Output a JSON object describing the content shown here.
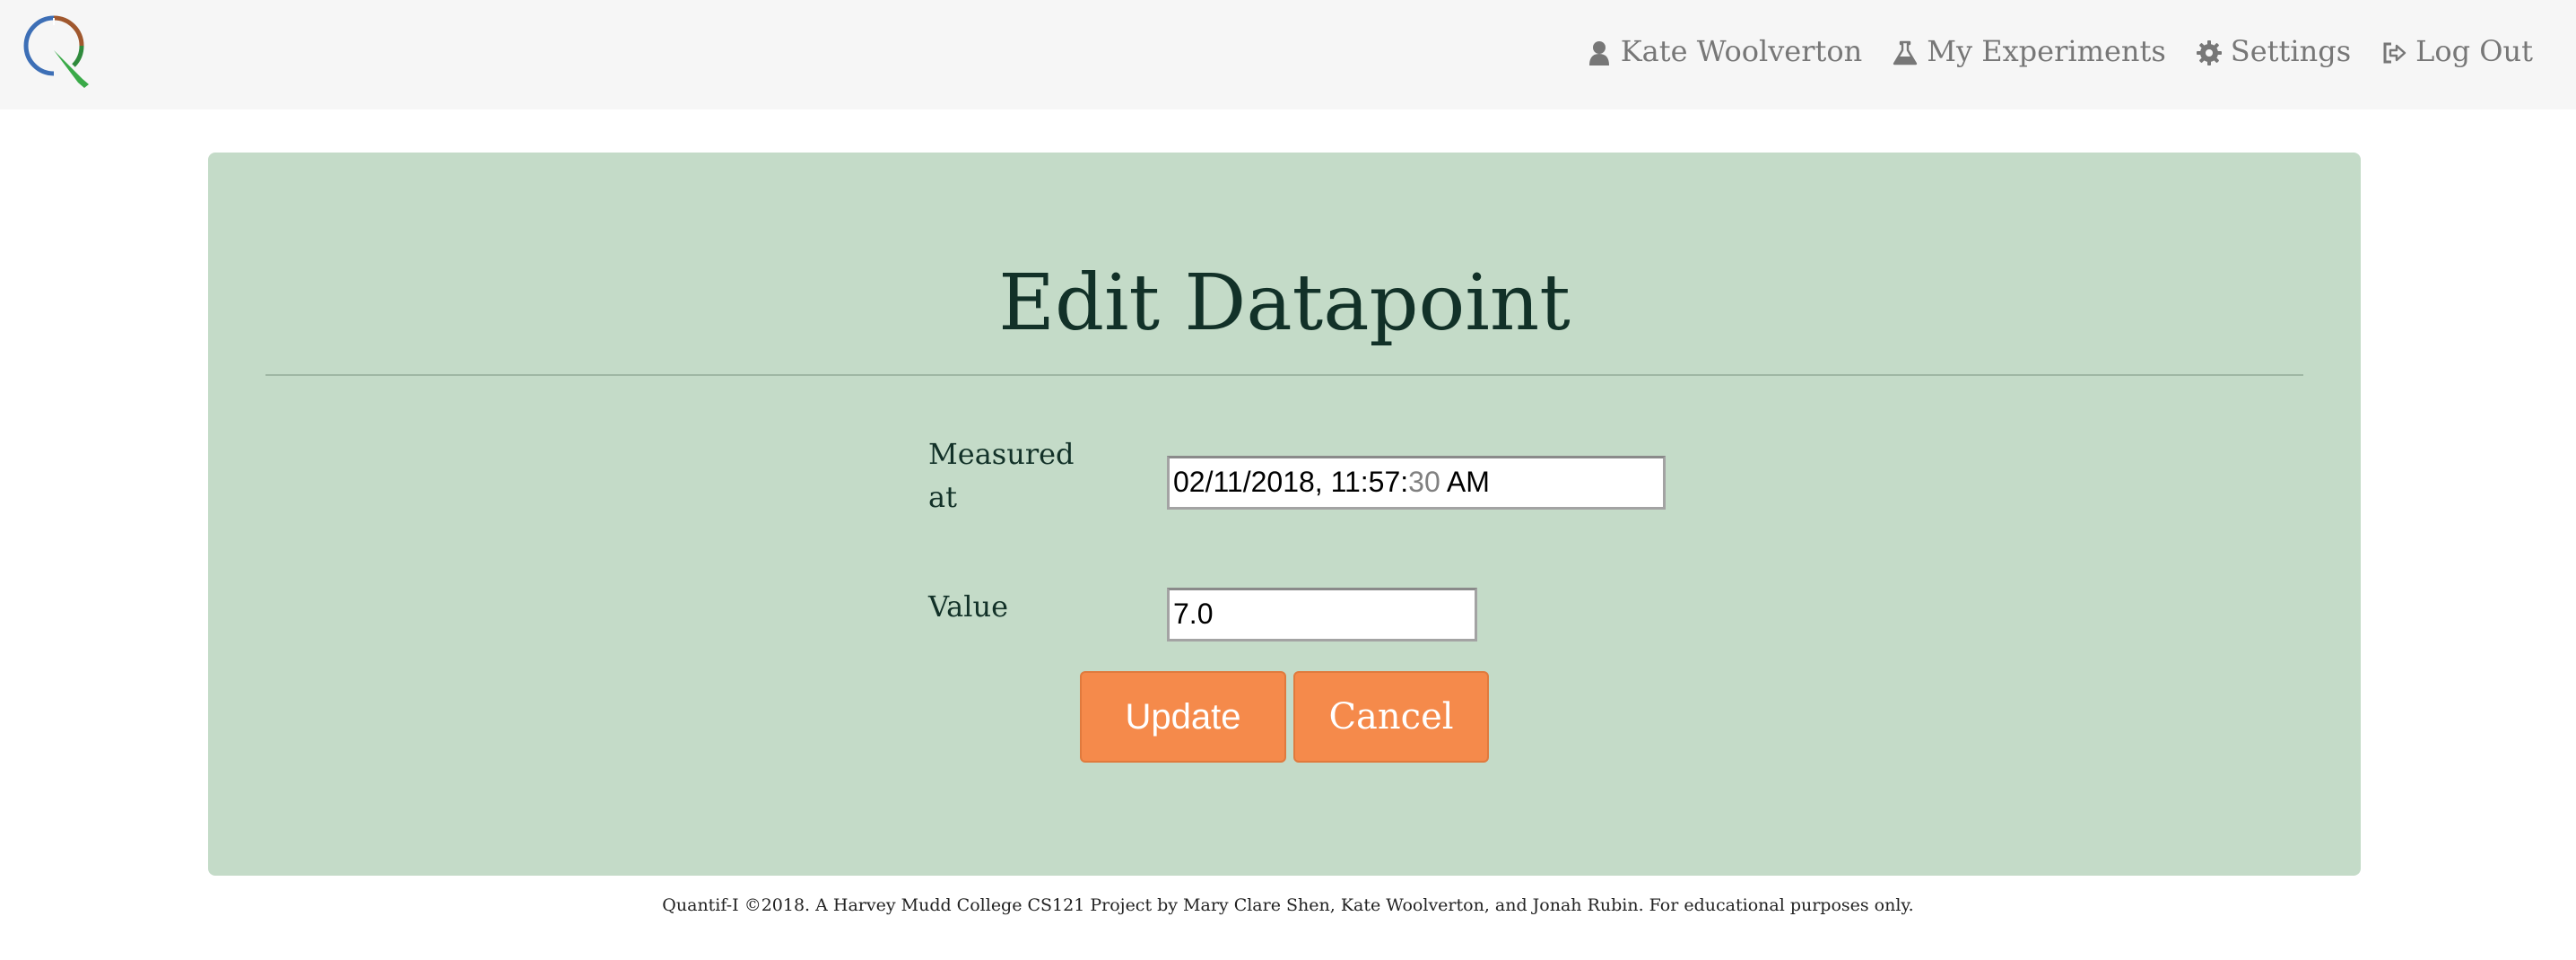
{
  "nav": {
    "logo_name": "quantif-i-logo",
    "user_name": "Kate Woolverton",
    "experiments_label": "My Experiments",
    "settings_label": "Settings",
    "logout_label": "Log Out"
  },
  "form": {
    "title": "Edit Datapoint",
    "measured_label": "Measured at",
    "datetime": {
      "date": "02/11/2018",
      "separator": ",",
      "hour": "11",
      "minute": "57",
      "second": "30",
      "ampm": "AM"
    },
    "value_label": "Value",
    "value": "7.0",
    "update_label": "Update",
    "cancel_label": "Cancel"
  },
  "footer": {
    "text": "Quantif-I ©2018. A Harvey Mudd College CS121 Project by Mary Clare Shen, Kate Woolverton, and Jonah Rubin. For educational purposes only."
  },
  "colors": {
    "navbar_bg": "#f6f6f6",
    "panel_bg": "#c4dbc8",
    "button_bg": "#f58a4b",
    "nav_text": "#777777",
    "logo_blue": "#3d6fb6",
    "logo_brown": "#a0582e",
    "logo_green": "#3aaa48"
  }
}
